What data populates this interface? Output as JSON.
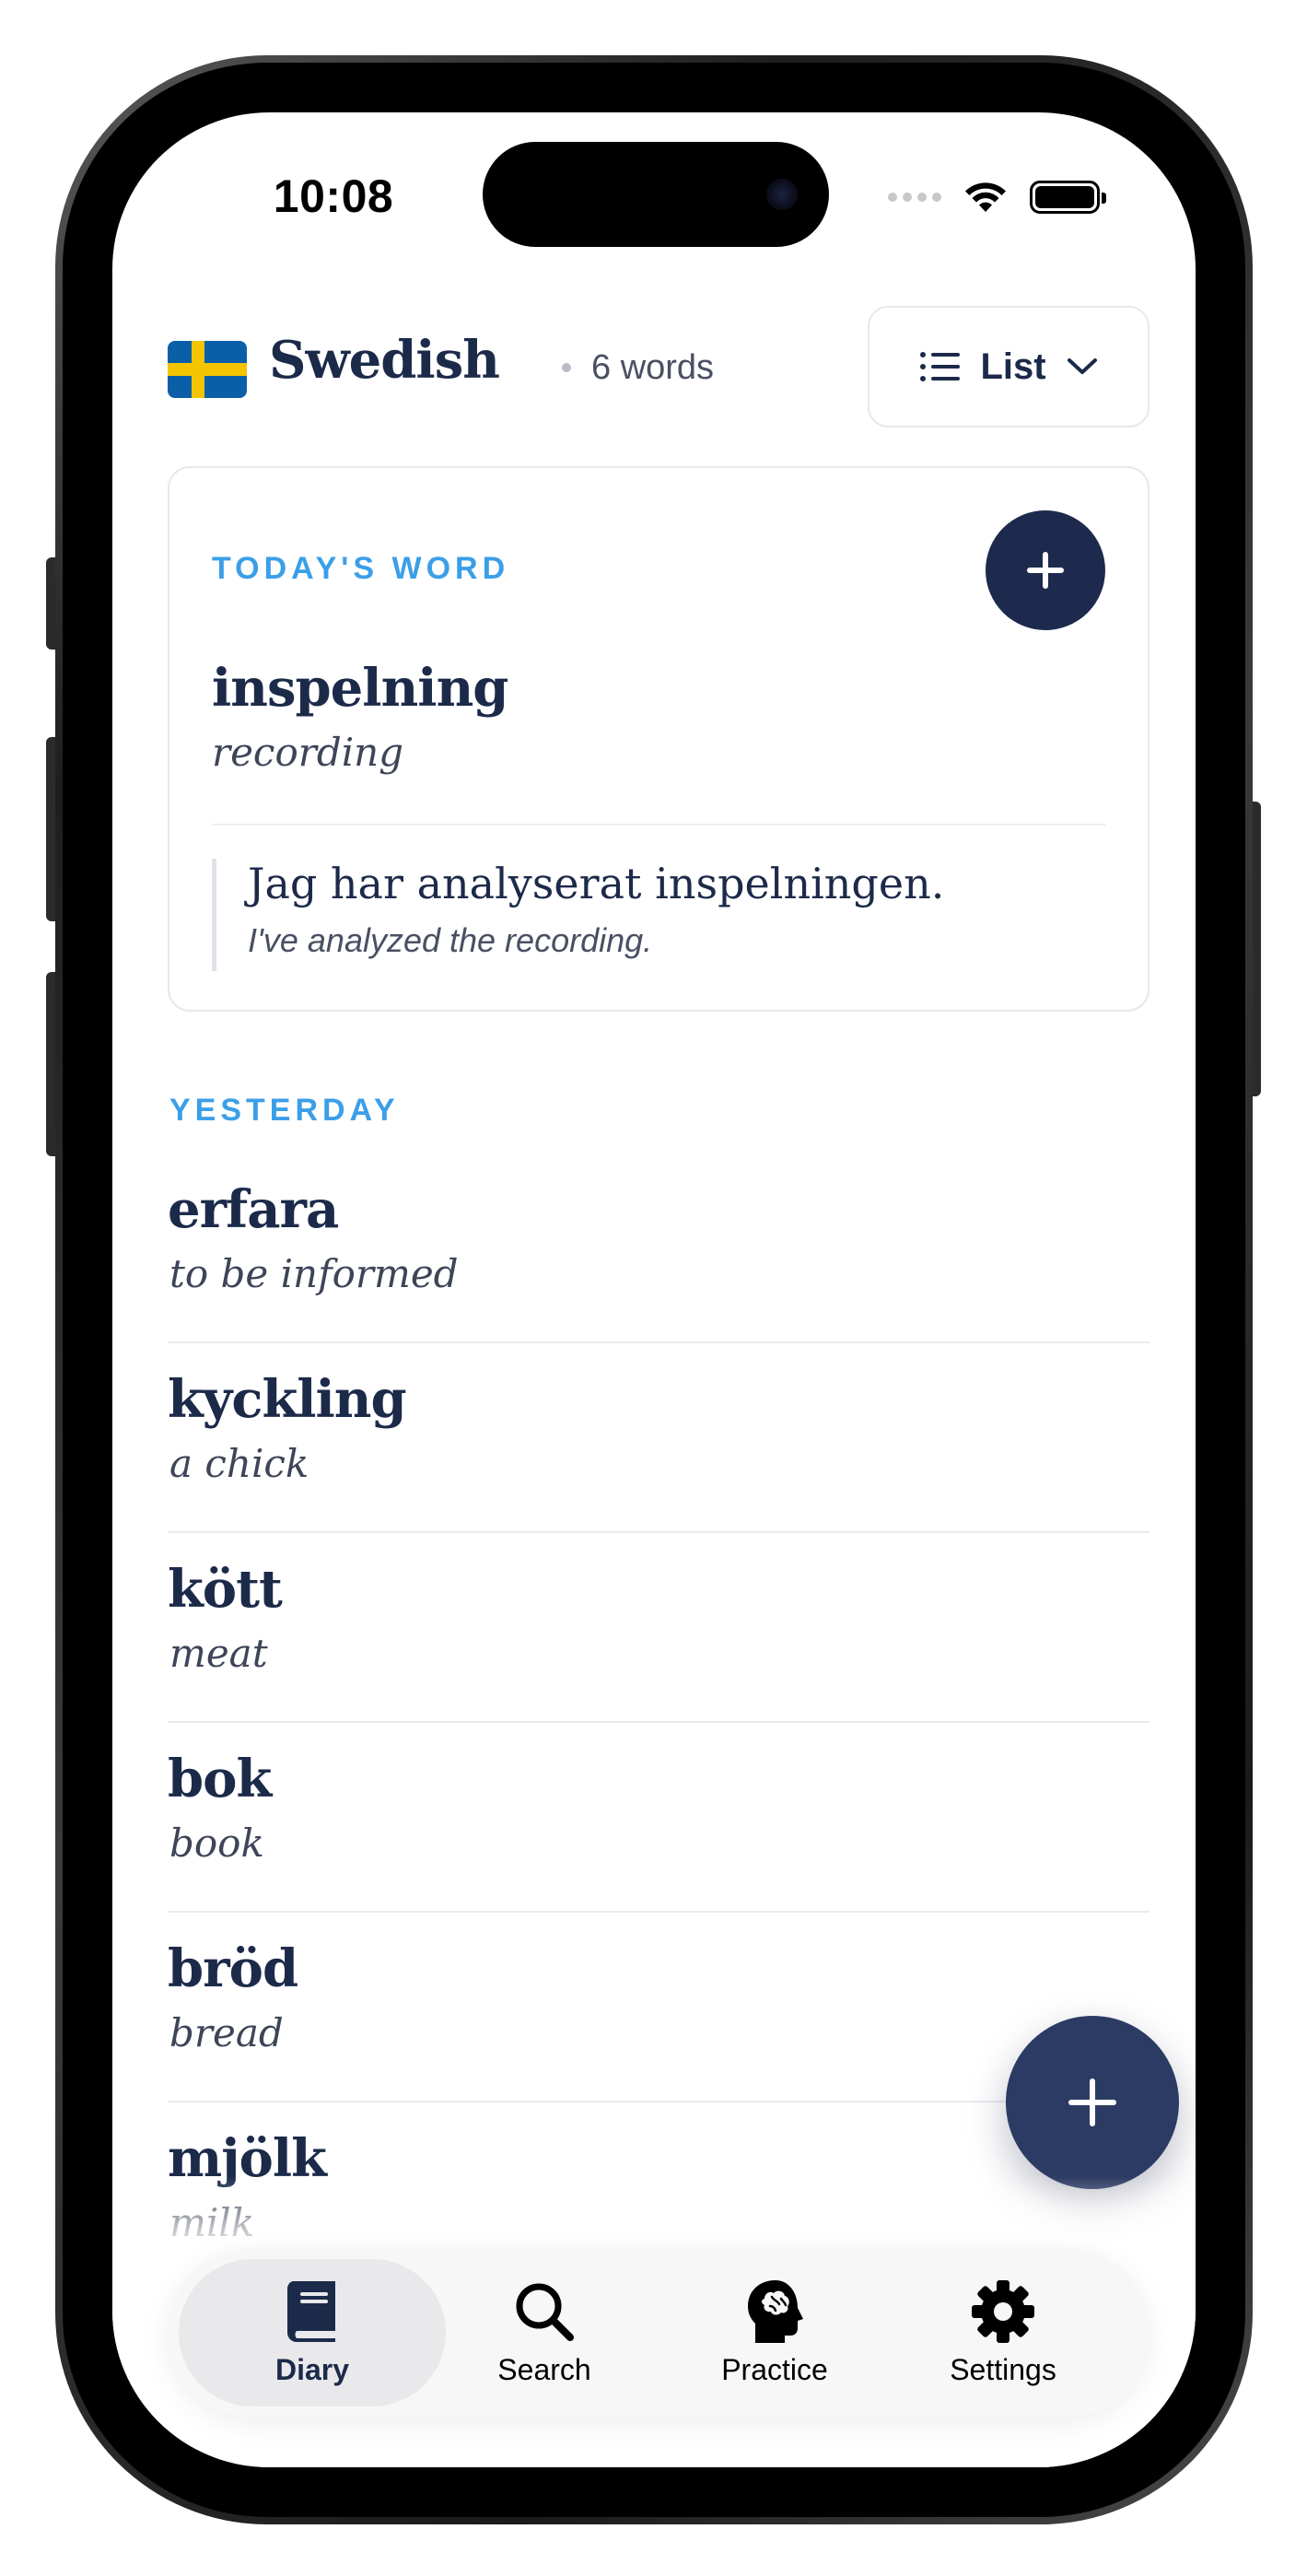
{
  "status_bar": {
    "time": "10:08"
  },
  "header": {
    "language": "Swedish",
    "word_count": "6 words",
    "view_toggle_label": "List"
  },
  "today": {
    "section_label": "TODAY'S WORD",
    "word": "inspelning",
    "translation": "recording",
    "example_sentence": "Jag har analyserat inspelningen.",
    "example_translation": "I've analyzed the recording."
  },
  "yesterday": {
    "section_label": "YESTERDAY",
    "words": [
      {
        "word": "erfara",
        "translation": "to be informed"
      },
      {
        "word": "kyckling",
        "translation": "a chick"
      },
      {
        "word": "kött",
        "translation": "meat"
      },
      {
        "word": "bok",
        "translation": "book"
      },
      {
        "word": "bröd",
        "translation": "bread"
      },
      {
        "word": "mjölk",
        "translation": "milk"
      }
    ]
  },
  "tabs": [
    {
      "label": "Diary",
      "icon": "book-icon",
      "active": true
    },
    {
      "label": "Search",
      "icon": "search-icon",
      "active": false
    },
    {
      "label": "Practice",
      "icon": "brain-head-icon",
      "active": false
    },
    {
      "label": "Settings",
      "icon": "gear-icon",
      "active": false
    }
  ],
  "colors": {
    "ink": "#1c2a4a",
    "accent_label": "#3b9fe8",
    "fab": "#2c3b63",
    "flag_blue": "#0a5fa8",
    "flag_yellow": "#f5c400"
  }
}
